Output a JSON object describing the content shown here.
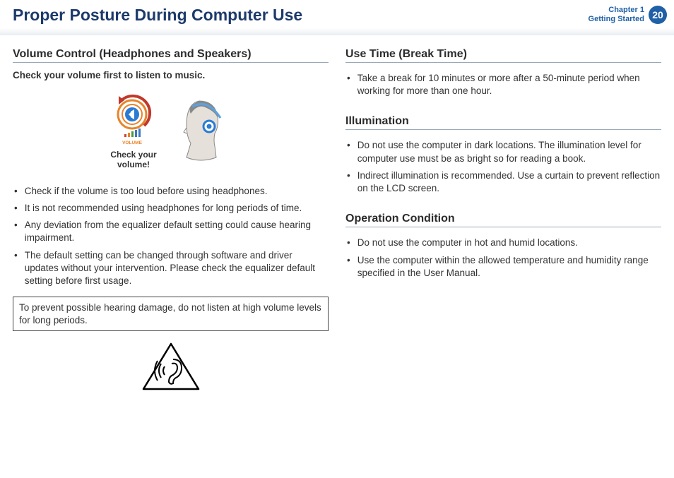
{
  "header": {
    "title": "Proper Posture During Computer Use",
    "chapter_line1": "Chapter 1",
    "chapter_line2": "Getting Started",
    "page_number": "20"
  },
  "left": {
    "section_title": "Volume Control (Headphones and Speakers)",
    "subhead": "Check your volume first to listen to music.",
    "illus_caption_l1": "Check your",
    "illus_caption_l2": "volume!",
    "vol_word": "VOLUME",
    "bullets": [
      "Check if the volume is too loud before using headphones.",
      "It is not recommended using headphones for long periods of time.",
      "Any deviation from the equalizer default setting could cause hearing impairment.",
      "The default setting can be changed through software and driver updates without your intervention. Please check the equalizer default setting before first usage."
    ],
    "warning": "To prevent possible hearing damage, do not listen at high volume levels for long periods."
  },
  "right": {
    "sections": [
      {
        "title": "Use Time (Break Time)",
        "bullets": [
          "Take a break for 10 minutes or more after a 50-minute period when working for more than one hour."
        ]
      },
      {
        "title": "Illumination",
        "bullets": [
          "Do not use the computer in dark locations. The illumination level for computer use must be as bright so for reading a book.",
          "Indirect illumination is recommended. Use a curtain to prevent reflection on the LCD screen."
        ]
      },
      {
        "title": "Operation Condition",
        "bullets": [
          "Do not use the computer in hot and humid locations.",
          "Use the computer within the allowed temperature and humidity range specified in the User Manual."
        ]
      }
    ]
  }
}
